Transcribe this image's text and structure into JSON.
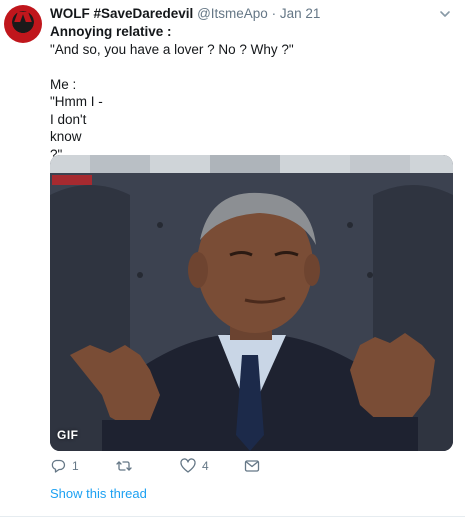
{
  "tweet": {
    "display_name": "WOLF #SaveDaredevil",
    "handle": "@ItsmeApo",
    "separator": "·",
    "date": "Jan 21",
    "lines": [
      "Annoying relative :",
      "\"And so, you have a lover ? No ? Why ?\"",
      "",
      "Me :",
      "\"Hmm I -",
      "I don't",
      "know",
      "?\""
    ],
    "media": {
      "type_badge": "GIF",
      "watermark": "SRCRC"
    },
    "actions": {
      "reply": {
        "icon": "reply-icon",
        "count": "1"
      },
      "retweet": {
        "icon": "retweet-icon",
        "count": ""
      },
      "like": {
        "icon": "heart-icon",
        "count": "4"
      },
      "message": {
        "icon": "envelope-icon"
      }
    },
    "show_thread": "Show this thread"
  },
  "colors": {
    "link": "#1da1f2",
    "muted": "#657786",
    "text": "#14171a"
  }
}
